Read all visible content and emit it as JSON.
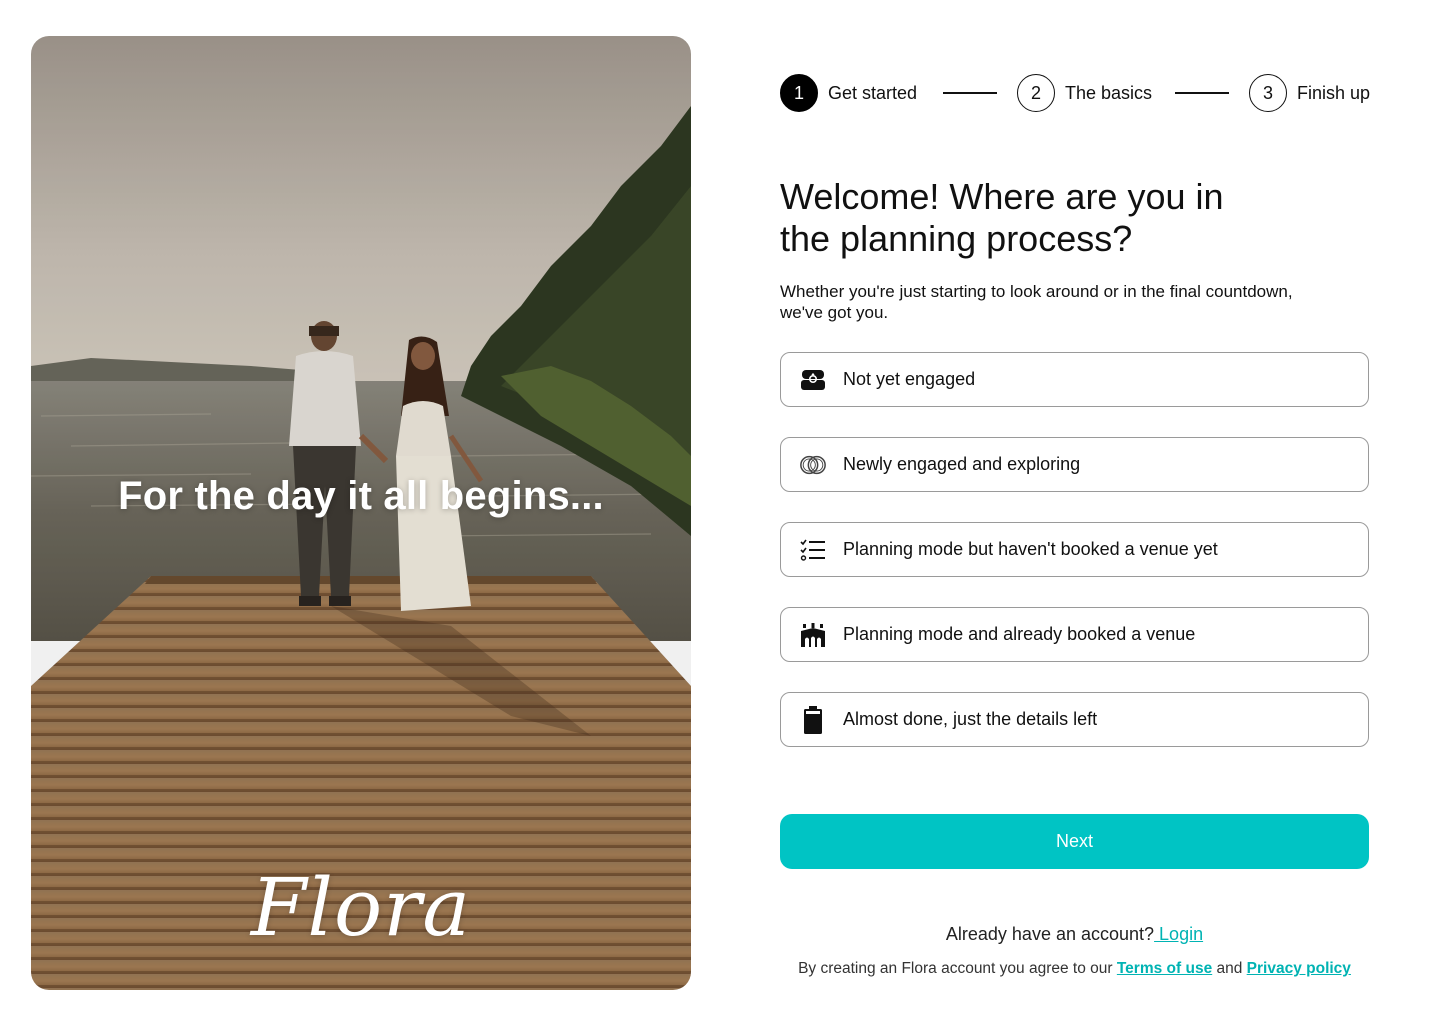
{
  "hero": {
    "tagline": "For the day it all begins...",
    "logo": "Flora"
  },
  "stepper": {
    "steps": [
      {
        "number": "1",
        "label": "Get started",
        "state": "active"
      },
      {
        "number": "2",
        "label": "The basics",
        "state": "inactive"
      },
      {
        "number": "3",
        "label": "Finish up",
        "state": "inactive"
      }
    ]
  },
  "main": {
    "title_line1": "Welcome! Where are you in",
    "title_line2": "the planning process?",
    "subtitle_line1": "Whether you're just starting to look around or in the final countdown,",
    "subtitle_line2": "we've got you.",
    "options": [
      {
        "label": "Not yet engaged",
        "icon": "ring-box-icon"
      },
      {
        "label": "Newly engaged and exploring",
        "icon": "interlocking-rings-icon"
      },
      {
        "label": "Planning mode but haven't booked a venue yet",
        "icon": "checklist-icon"
      },
      {
        "label": "Planning mode and already booked a venue",
        "icon": "venue-icon"
      },
      {
        "label": "Almost done, just the details left",
        "icon": "battery-icon"
      }
    ],
    "next_label": "Next"
  },
  "footer": {
    "account_prompt": "Already have an account?",
    "login_label": " Login",
    "legal_prefix": "By creating an Flora account you agree to our ",
    "terms_label": "Terms of use",
    "legal_and": " and ",
    "privacy_label": "Privacy policy"
  },
  "colors": {
    "accent": "#00c4c4",
    "link": "#00b3b3",
    "text": "#111111",
    "border": "#9a9a9a"
  }
}
